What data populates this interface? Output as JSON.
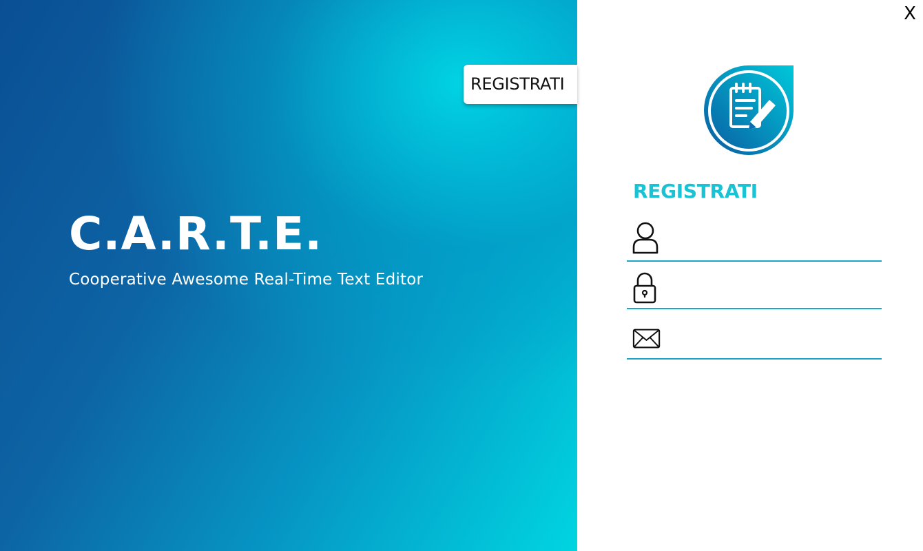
{
  "window": {
    "close_label": "X"
  },
  "brand": {
    "title": "C.A.R.T.E.",
    "subtitle": "Cooperative Awesome Real-Time Text Editor"
  },
  "tab": {
    "label": "REGISTRATI"
  },
  "logo": {
    "icon": "notepad-pencil-icon"
  },
  "form": {
    "heading": "REGISTRATI",
    "fields": [
      {
        "name": "username",
        "icon": "user-icon",
        "value": "",
        "placeholder": ""
      },
      {
        "name": "password",
        "icon": "lock-icon",
        "value": "",
        "placeholder": ""
      },
      {
        "name": "email",
        "icon": "envelope-icon",
        "value": "",
        "placeholder": ""
      }
    ]
  },
  "colors": {
    "accent": "#19c3d4",
    "gradient_dark": "#0a4f94",
    "gradient_light": "#00d5e1",
    "underline": "#1aa6c8"
  }
}
